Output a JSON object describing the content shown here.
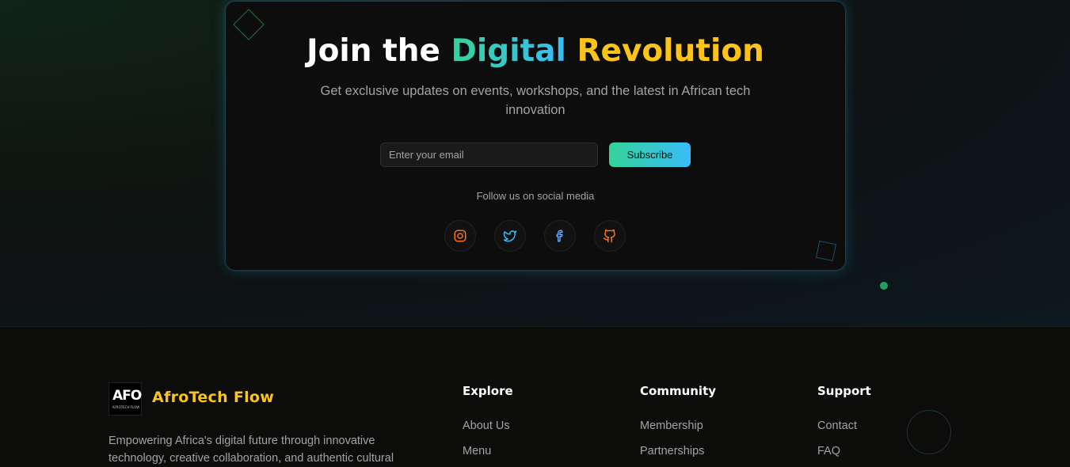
{
  "hero": {
    "title_part1": "Join the ",
    "title_part2": "Digital",
    "title_part3": " Revolution",
    "subtitle": "Get exclusive updates on events, workshops, and the latest in African tech innovation",
    "email_placeholder": "Enter your email",
    "subscribe_label": "Subscribe",
    "follow_text": "Follow us on social media",
    "social_icons": [
      "instagram-icon",
      "twitter-icon",
      "facebook-icon",
      "github-icon"
    ]
  },
  "footer": {
    "logo_text": "AFO",
    "logo_small_text": "AFROTECH FLOW",
    "brand_name": "AfroTech Flow",
    "tagline": "Empowering Africa's digital future through innovative technology, creative collaboration, and authentic cultural",
    "columns": [
      {
        "title": "Explore",
        "links": [
          "About Us",
          "Menu"
        ]
      },
      {
        "title": "Community",
        "links": [
          "Membership",
          "Partnerships"
        ]
      },
      {
        "title": "Support",
        "links": [
          "Contact",
          "FAQ"
        ]
      }
    ]
  },
  "colors": {
    "accent_green": "#34d399",
    "accent_blue": "#38bdf8",
    "accent_yellow": "#fcc419",
    "instagram": "#f97316",
    "twitter": "#38bdf8",
    "facebook": "#60a5fa",
    "github": "#f97316"
  }
}
